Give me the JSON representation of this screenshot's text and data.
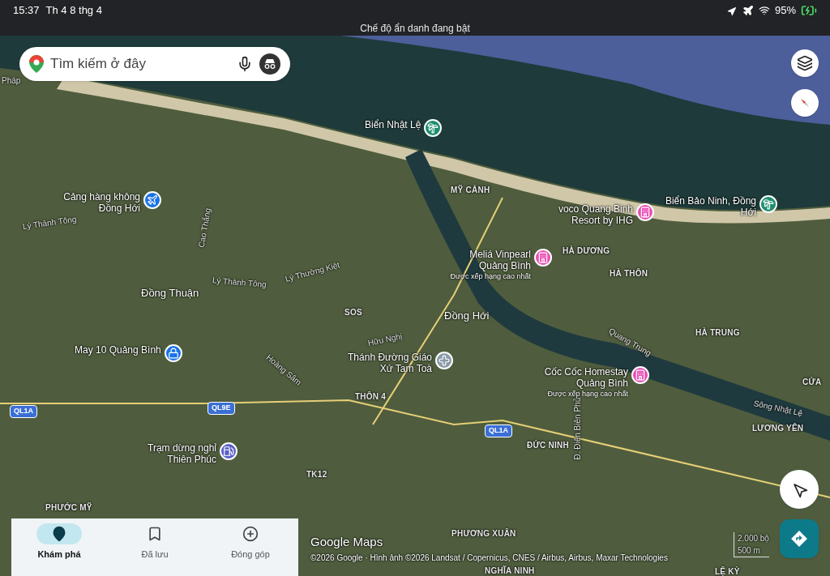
{
  "status_bar": {
    "time": "15:37",
    "date": "Th 4 8 thg 4",
    "battery": "95%"
  },
  "banner": "Chế độ ẩn danh đang bật",
  "search": {
    "placeholder": "Tìm kiếm ở đây"
  },
  "pois": [
    {
      "kind": "beach",
      "name": "Biển Nhật Lệ",
      "color": "#1e8e6e"
    },
    {
      "kind": "airport",
      "name": "Cảng hàng không Đồng Hới",
      "color": "#1a73e8"
    },
    {
      "kind": "hotel",
      "name": "voco Quang Binh Resort by IHG",
      "color": "#e84fb3"
    },
    {
      "kind": "beach",
      "name": "Biển Bảo Ninh, Đồng Hới",
      "color": "#1e8e6e"
    },
    {
      "kind": "hotel",
      "name": "Meliá Vinpearl Quảng Bình",
      "subtitle": "Được xếp hạng cao nhất",
      "color": "#e84fb3"
    },
    {
      "kind": "church",
      "name": "Thánh Đường Giáo Xứ Tam Toà",
      "color": "#8a9aa8"
    },
    {
      "kind": "hotel",
      "name": "Cốc Cốc Homestay Quảng Bình",
      "subtitle": "Được xếp hạng cao nhất",
      "color": "#e84fb3"
    },
    {
      "kind": "shop",
      "name": "May 10 Quảng Bình",
      "color": "#1a73e8"
    },
    {
      "kind": "gas",
      "name": "Trạm dừng nghỉ Thiên Phúc",
      "color": "#5b5fc7"
    }
  ],
  "labels": [
    {
      "kind": "road",
      "text": "Pháp"
    },
    {
      "kind": "road",
      "text": "Lý Thành Tông"
    },
    {
      "kind": "road",
      "text": "Cao Thắng"
    },
    {
      "kind": "road",
      "text": "Lý Thành Tông"
    },
    {
      "kind": "road",
      "text": "Lý Thường Kiệt"
    },
    {
      "kind": "town",
      "text": "Đồng Thuận"
    },
    {
      "kind": "place",
      "text": "SOS"
    },
    {
      "kind": "place",
      "text": "MỸ CẢNH"
    },
    {
      "kind": "place",
      "text": "HÀ DƯƠNG"
    },
    {
      "kind": "place",
      "text": "HÀ THÔN"
    },
    {
      "kind": "town",
      "text": "Đồng Hới"
    },
    {
      "kind": "road",
      "text": "Hữu Nghị"
    },
    {
      "kind": "road",
      "text": "Hoàng Sâm"
    },
    {
      "kind": "road",
      "text": "Quang Trung"
    },
    {
      "kind": "place",
      "text": "HÀ TRUNG"
    },
    {
      "kind": "place",
      "text": "CỬA"
    },
    {
      "kind": "road",
      "text": "Sông Nhật Lệ"
    },
    {
      "kind": "place",
      "text": "LƯƠNG YÊN"
    },
    {
      "kind": "shield",
      "text": "QL9E"
    },
    {
      "kind": "shield",
      "text": "QL1A"
    },
    {
      "kind": "place",
      "text": "THÔN 4"
    },
    {
      "kind": "shield",
      "text": "QL1A"
    },
    {
      "kind": "place",
      "text": "ĐỨC NINH"
    },
    {
      "kind": "road",
      "text": "Đ. Điện Biên Phủ"
    },
    {
      "kind": "place",
      "text": "TK12"
    },
    {
      "kind": "place",
      "text": "PHƯỚC MỸ"
    },
    {
      "kind": "place",
      "text": "PHƯƠNG XUÂN"
    },
    {
      "kind": "place",
      "text": "NGHĨA NINH"
    },
    {
      "kind": "place",
      "text": "LỆ KỲ"
    }
  ],
  "attribution": {
    "logo": "Google Maps",
    "copyright": "©2026 Google · Hình ảnh ©2026 Landsat / Copernicus, CNES / Airbus, Airbus, Maxar Technologies"
  },
  "scale": {
    "imperial": "2.000 bộ",
    "metric": "500 m"
  },
  "nav": [
    {
      "label": "Khám phá",
      "selected": true
    },
    {
      "label": "Đã lưu",
      "selected": false
    },
    {
      "label": "Đóng góp",
      "selected": false
    }
  ]
}
